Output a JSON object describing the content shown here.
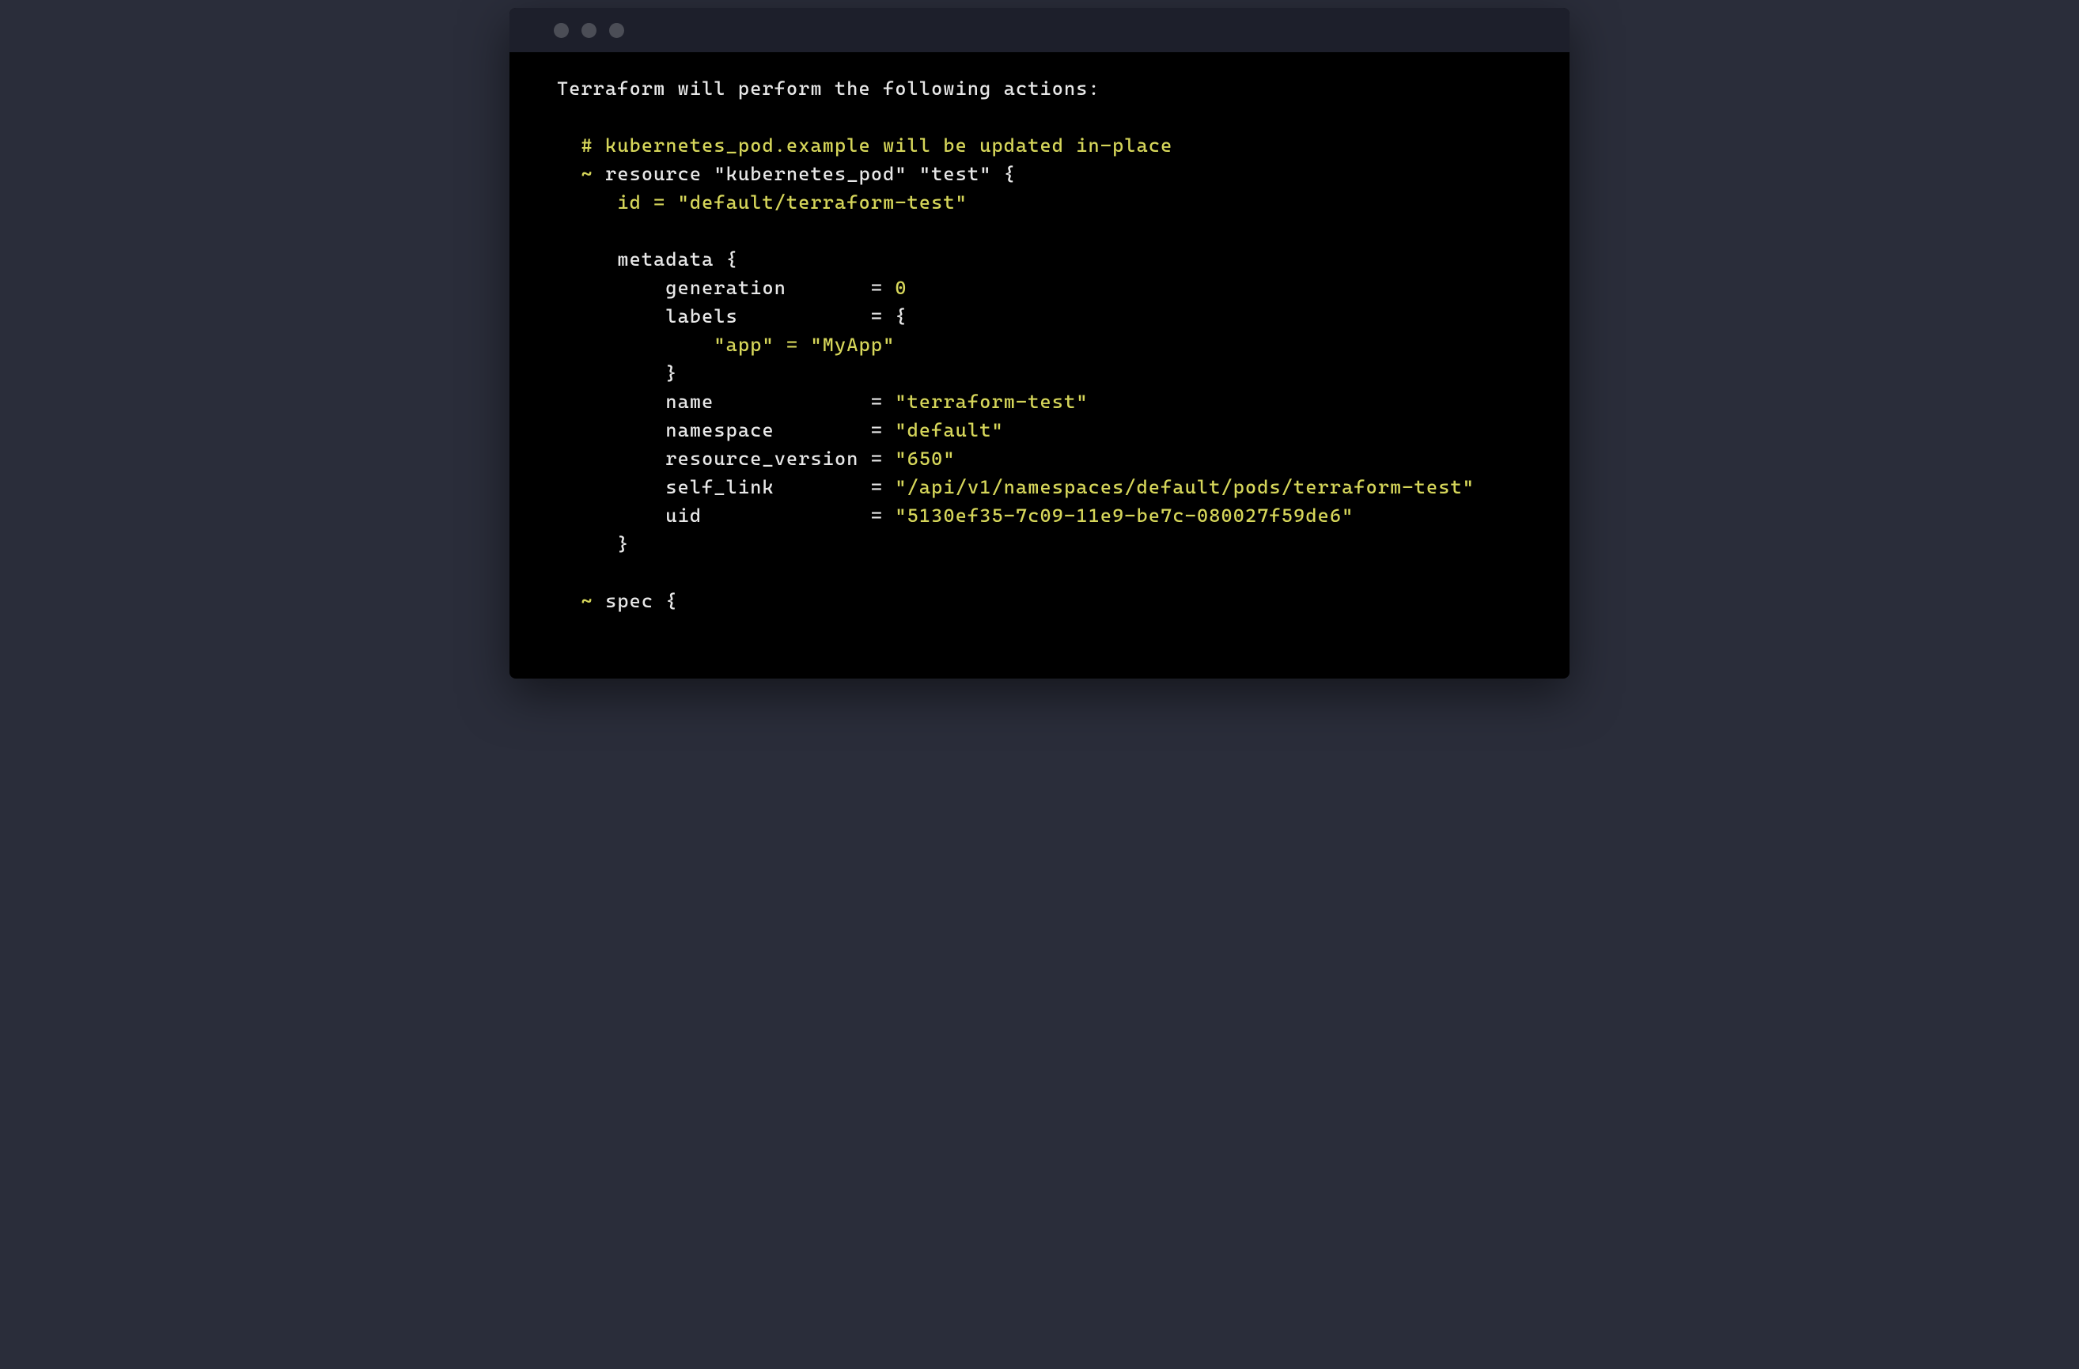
{
  "header": "Terraform will perform the following actions:",
  "comment": "# kubernetes_pod.example will be updated in-place",
  "update_marker": "~",
  "resource_keyword": "resource",
  "resource_type": "\"kubernetes_pod\"",
  "resource_name": "\"test\"",
  "id_key": "id",
  "id_value": "\"default/terraform-test\"",
  "metadata_block": "metadata",
  "gen_key": "generation",
  "gen_value": "0",
  "labels_key": "labels",
  "app_key": "\"app\"",
  "app_value": "\"MyApp\"",
  "name_key": "name",
  "name_value": "\"terraform-test\"",
  "ns_key": "namespace",
  "ns_value": "\"default\"",
  "rv_key": "resource_version",
  "rv_value": "\"650\"",
  "sl_key": "self_link",
  "sl_value": "\"/api/v1/namespaces/default/pods/terraform-test\"",
  "uid_key": "uid",
  "uid_value": "\"5130ef35-7c09-11e9-be7c-080027f59de6\"",
  "spec_block": "spec",
  "eq": "=",
  "brace_open": "{",
  "brace_close": "}"
}
